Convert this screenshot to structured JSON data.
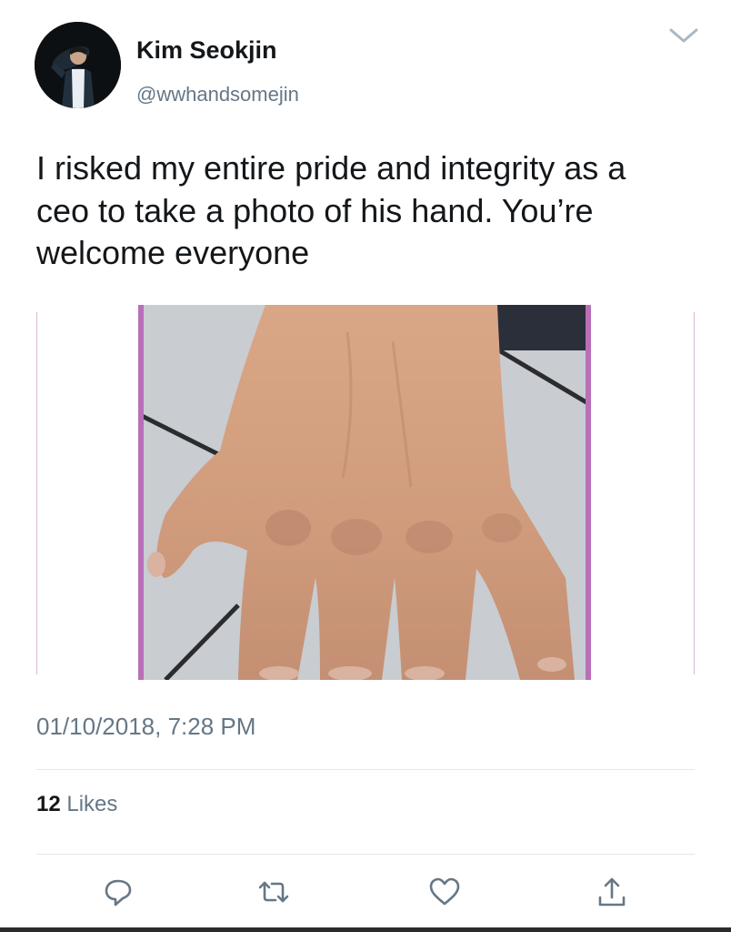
{
  "author": {
    "name": "Kim Seokjin",
    "handle": "@wwhandsomejin"
  },
  "tweet": {
    "text_lines": [
      "I risked my entire pride and integrity as a",
      "ceo to take a photo of his hand. You’re",
      "welcome everyone"
    ],
    "timestamp": "01/10/2018, 7:28 PM"
  },
  "stats": {
    "likes_count": "12",
    "likes_label": "Likes"
  },
  "icons": {
    "caret": "chevron-down-icon",
    "reply": "reply-icon",
    "retweet": "retweet-icon",
    "like": "heart-icon",
    "share": "share-icon"
  },
  "colors": {
    "text": "#14171a",
    "secondary": "#657786",
    "divider": "#e1e8ed",
    "photo_frame": "#b86fb8"
  }
}
